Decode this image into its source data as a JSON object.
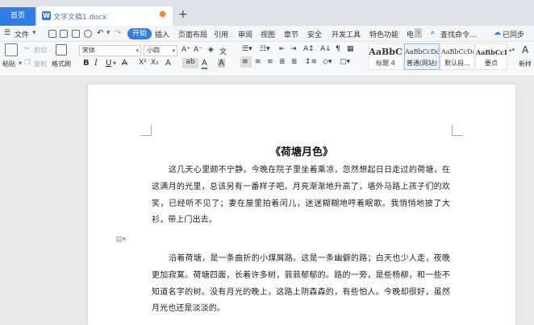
{
  "tabs": {
    "home": "首页",
    "doc_title": "文字文稿1.docx",
    "modified_dot": "●",
    "new_tab": "+"
  },
  "menu": {
    "file": "文件",
    "items": [
      "开始",
      "插入",
      "页面布局",
      "引用",
      "审阅",
      "视图",
      "章节",
      "安全",
      "开发工具",
      "特色功能",
      "电"
    ],
    "search": "查找命令...",
    "sync": "已同步"
  },
  "ribbon": {
    "paste": "粘贴",
    "cut": "剪切",
    "copy": "复制",
    "format_painter": "格式刷",
    "font": "宋体",
    "size": "小四",
    "styles": [
      {
        "sample": "AaBbC",
        "name": "标题 4"
      },
      {
        "sample": "AaBbCcDd",
        "name": "普通(网站)"
      },
      {
        "sample": "AaBbCcDd",
        "name": "默认段..."
      },
      {
        "sample": "AaBbCcDd",
        "name": "要点"
      }
    ],
    "new_style": "新样"
  },
  "document": {
    "title": "《荷塘月色》",
    "paragraphs": [
      "这几天心里颇不宁静。今晚在院子里坐着乘凉，忽然想起日日走过的荷塘，在这满月的光里，总该另有一番样子吧。月亮渐渐地升高了，墙外马路上孩子们的欢笑，已经听不见了；妻在屋里拍着闰儿，迷迷糊糊地哼着眠歌。我悄悄地披了大衫，带上门出去。",
      "沿着荷塘，是一条曲折的小煤屑路。这是一条幽僻的路；白天也少人走，夜晚更加寂寞。荷塘四面，长着许多树，蓊蓊郁郁的。路的一旁，是些杨柳，和一些不知道名字的树。没有月光的晚上，这路上阴森森的，有些怕人。今晚却很好，虽然月光也还是淡淡的。"
    ]
  },
  "colors": {
    "accent": "#2f7ee8",
    "modified": "#f08a3a"
  }
}
